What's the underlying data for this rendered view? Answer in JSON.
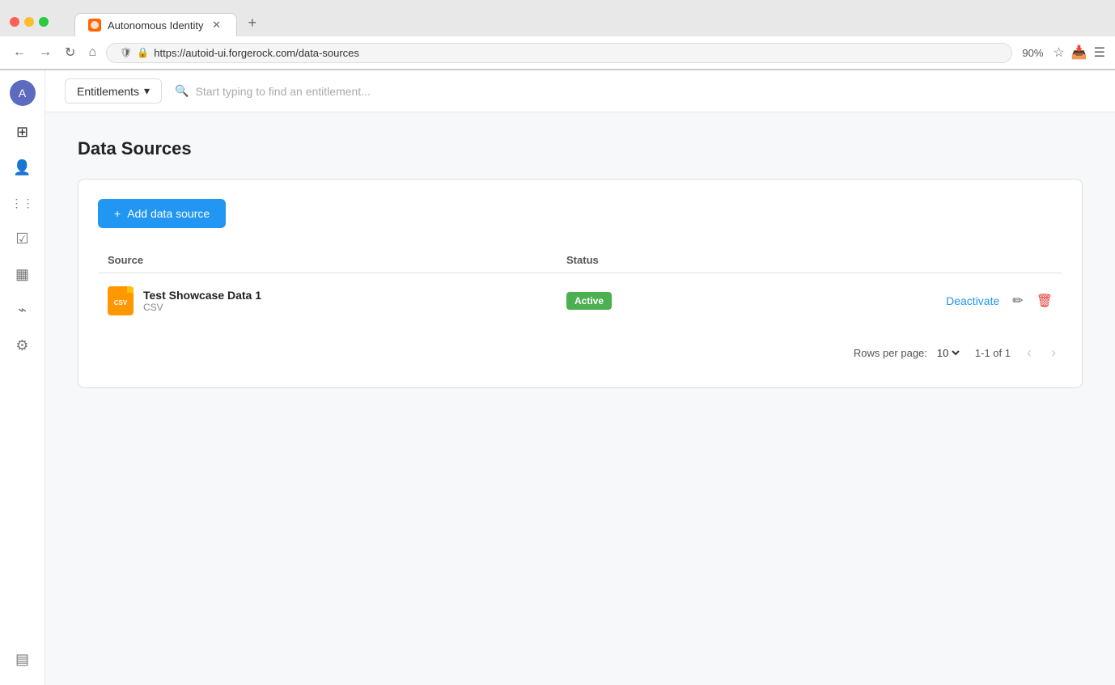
{
  "browser": {
    "traffic_lights": [
      "close",
      "minimize",
      "maximize"
    ],
    "tab_title": "Autonomous Identity",
    "tab_icon": "ai-icon",
    "url": "https://autoid-ui.forgerock.com/data-sources",
    "zoom": "90%",
    "new_tab_label": "+"
  },
  "nav": {
    "entitlements_label": "Entitlements",
    "search_placeholder": "Start typing to find an entitlement..."
  },
  "sidebar": {
    "items": [
      {
        "id": "dashboard",
        "icon": "⊞",
        "label": "Dashboard"
      },
      {
        "id": "users",
        "icon": "👤",
        "label": "Users"
      },
      {
        "id": "apps",
        "icon": "⋮⋮",
        "label": "Applications"
      },
      {
        "id": "tasks",
        "icon": "✓",
        "label": "Tasks"
      },
      {
        "id": "data",
        "icon": "▦",
        "label": "Data"
      },
      {
        "id": "rules",
        "icon": "⌁",
        "label": "Rules"
      },
      {
        "id": "settings",
        "icon": "⚙",
        "label": "Settings"
      }
    ],
    "bottom_items": [
      {
        "id": "table-view",
        "icon": "▤",
        "label": "Table View"
      }
    ]
  },
  "page": {
    "title": "Data Sources",
    "add_button_label": "Add data source",
    "table": {
      "headers": [
        "Source",
        "Status"
      ],
      "rows": [
        {
          "name": "Test Showcase Data 1",
          "type": "CSV",
          "status": "Active",
          "status_color": "#4caf50",
          "deactivate_label": "Deactivate"
        }
      ]
    },
    "pagination": {
      "rows_per_page_label": "Rows per page:",
      "rows_per_page_value": "10",
      "page_info": "1-1 of 1"
    }
  }
}
